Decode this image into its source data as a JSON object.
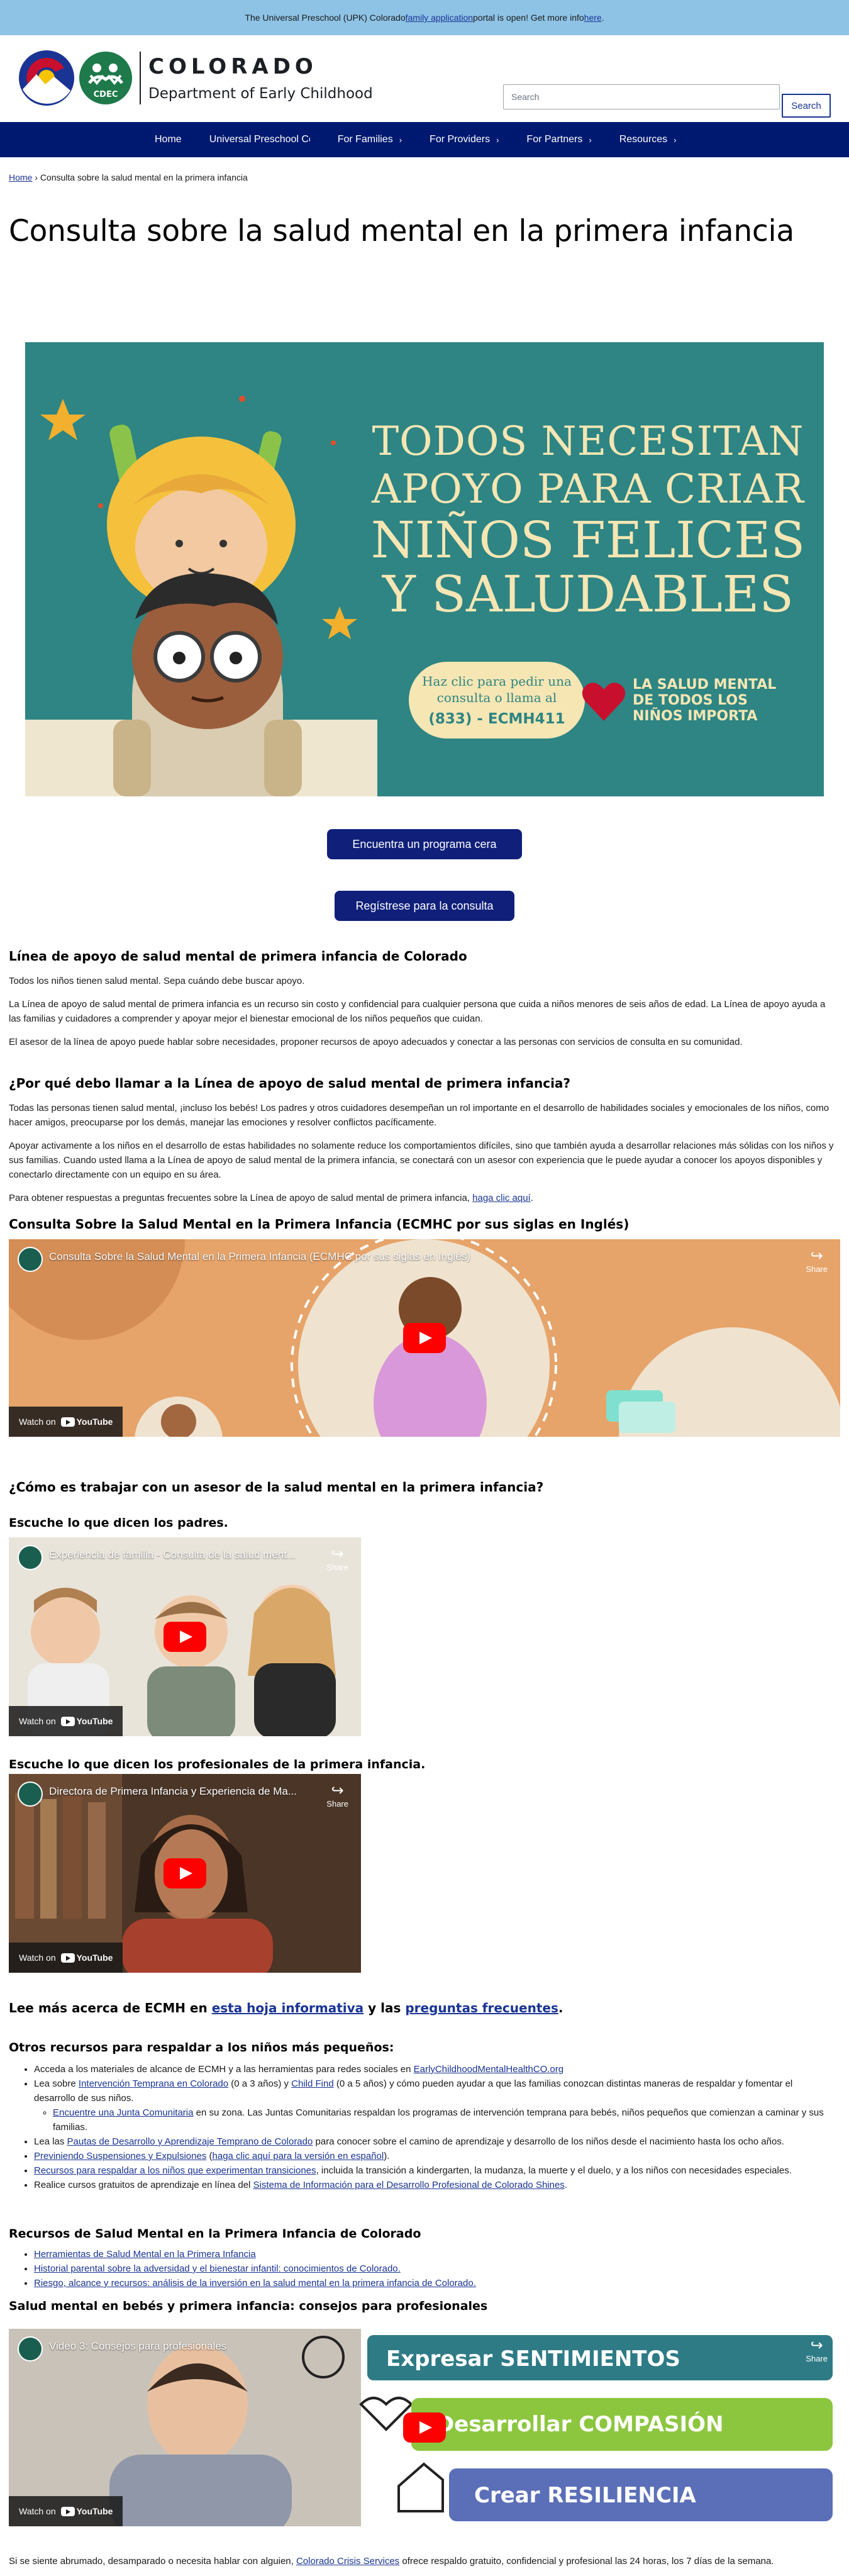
{
  "announcement": {
    "text_before": "The Universal Preschool (UPK) Colorado ",
    "link1": "family application",
    "text_middle": " portal is open! Get more info ",
    "link2": "here",
    "text_after": "."
  },
  "header": {
    "logo_state": "COLORADO",
    "logo_dept": "Department of Early Childhood",
    "logo_cdec": "CDEC",
    "search_placeholder": "Search",
    "search_button": "Search"
  },
  "nav": {
    "items": [
      {
        "label": "Home",
        "has_children": false
      },
      {
        "label": "Universal Preschool Colorado",
        "has_children": false
      },
      {
        "label": "For Families",
        "has_children": true
      },
      {
        "label": "For Providers",
        "has_children": true
      },
      {
        "label": "For Partners",
        "has_children": true
      },
      {
        "label": "Resources",
        "has_children": true
      }
    ],
    "chevron": "›"
  },
  "breadcrumb": {
    "home": "Home",
    "separator": "›",
    "current": "Consulta sobre la salud mental en la primera infancia"
  },
  "page_title": "Consulta sobre la salud mental en la primera infancia",
  "banner": {
    "headline_1": "TODOS NECESITAN",
    "headline_2": "APOYO PARA CRIAR",
    "headline_3": "NIÑOS FELICES",
    "headline_4": "Y SALUDABLES",
    "pill_line1": "Haz clic para pedir una",
    "pill_line2": "consulta o llama al",
    "pill_phone": "(833) - ECMH411",
    "tagline_1": "LA SALUD MENTAL",
    "tagline_2": "DE TODOS LOS",
    "tagline_3": "NIÑOS IMPORTA",
    "colors": {
      "background": "#2e8583",
      "text": "#f6e6b4",
      "heart": "#c8102e"
    }
  },
  "buttons": {
    "find_program": "Encuentra un programa cera",
    "register": "Regístrese para la consulta"
  },
  "section1": {
    "heading": "Línea de apoyo de salud mental de primera infancia de Colorado",
    "p1": "Todos los niños tienen salud mental. Sepa cuándo debe buscar apoyo.",
    "p2": "La Línea de apoyo de salud mental de primera infancia es un recurso sin costo y confidencial para cualquier persona que cuida a niños menores de seis años de edad. La Línea de apoyo ayuda a las familias y cuidadores a comprender y apoyar mejor el bienestar emocional de los niños pequeños que cuidan.",
    "p3": "El asesor de la línea de apoyo puede hablar sobre necesidades, proponer recursos de apoyo adecuados y conectar a las personas con servicios de consulta en su comunidad."
  },
  "section2": {
    "heading": "¿Por qué debo llamar a la Línea de apoyo de salud mental de primera infancia?",
    "p1": "Todas las personas tienen salud mental, ¡incluso los bebés! Los padres y otros cuidadores desempeñan un rol importante en el desarrollo de habilidades sociales y emocionales de los niños, como hacer amigos, preocuparse por los demás, manejar las emociones y resolver conflictos pacíficamente.",
    "p2": "Apoyar activamente a los niños en el desarrollo de estas habilidades no solamente reduce los comportamientos difíciles, sino que también ayuda a desarrollar relaciones más sólidas con los niños y sus familias. Cuando usted llama a la Línea de apoyo de salud mental de la primera infancia, se conectará con un asesor con experiencia que le puede ayudar a conocer los apoyos disponibles y conectarlo directamente con un equipo en su área.",
    "p3_before": "Para obtener respuestas a preguntas frecuentes sobre la Línea de apoyo de salud mental de primera infancia, ",
    "p3_link": "haga clic aquí",
    "p3_after": "."
  },
  "video_section": {
    "heading": "Consulta Sobre la Salud Mental en la Primera Infancia (ECMHC por sus siglas en Inglés)"
  },
  "videos": {
    "v1_title": "Consulta Sobre la Salud Mental en la Primera Infancia (ECMHC por sus siglas en Inglés)",
    "v2_title": "Experiencia de familia - Consulta de la salud ment...",
    "v3_title": "Directora de Primera Infancia y Experiencia de Ma...",
    "v4_title": "Video 3: Consejos para profesionales",
    "share": "Share",
    "watch_on": "Watch on",
    "youtube": "YouTube",
    "v4_overlay_1": "Expresar SENTIMIENTOS",
    "v4_overlay_2": "Desarrollar COMPASIÓN",
    "v4_overlay_3": "Crear RESILIENCIA"
  },
  "section3": {
    "heading": "¿Cómo es trabajar con un asesor de la salud mental en la primera infancia?",
    "parents_heading": "Escuche lo que dicen los padres.",
    "pros_heading": "Escuche lo que dicen los profesionales de la primera infancia."
  },
  "learn_more": {
    "before": "Lee más acerca de ECMH en ",
    "link1": "esta hoja informativa",
    "middle": " y las ",
    "link2": "preguntas frecuentes",
    "after": "."
  },
  "other_resources": {
    "heading": "Otros recursos para respaldar a los niños más pequeños:",
    "items": [
      {
        "before": "Acceda a los materiales de alcance de ECMH y a las herramientas para redes sociales en ",
        "link": "EarlyChildhoodMentalHealthCO.org",
        "after": ""
      },
      {
        "before": "Lea sobre ",
        "link": "Intervención Temprana en Colorado",
        "after": " (0 a 3 años) y ",
        "link2": "Child Find",
        "after2": " (0 a 5 años) y cómo pueden ayudar a que las familias conozcan distintas maneras de respaldar y fomentar el desarrollo de sus niños."
      },
      {
        "before": "Lea las ",
        "link": "Pautas de Desarrollo y Aprendizaje Temprano de Colorado",
        "after": " para conocer sobre el camino de aprendizaje y desarrollo de los niños desde el nacimiento hasta los ocho años."
      },
      {
        "before": "",
        "link": "Previniendo Suspensiones y Expulsiones",
        "after": " (",
        "link2": "haga clic aquí para la versión en español",
        "after2": ")."
      },
      {
        "before": "",
        "link": "Recursos para respaldar a los niños que experimentan transiciones",
        "after": ", incluida la transición a kindergarten, la mudanza, la muerte y el duelo, y a los niños con necesidades especiales."
      },
      {
        "before": "Realice cursos gratuitos de aprendizaje en línea del ",
        "link": "Sistema de Información para el Desarrollo Profesional de Colorado Shines",
        "after": "."
      }
    ],
    "subitem": {
      "link": "Encuentre una Junta Comunitaria",
      "after": " en su zona. Las Juntas Comunitarias respaldan los programas de intervención temprana para bebés, niños pequeños que comienzan a caminar y sus familias."
    }
  },
  "mh_resources": {
    "heading": "Recursos de Salud Mental en la Primera Infancia de Colorado",
    "items": [
      "Herramientas de Salud Mental en la Primera Infancia",
      "Historial parental sobre la adversidad y el bienestar infantil: conocimientos de Colorado.",
      "Riesgo, alcance y recursos: análisis de la inversión en la salud mental en la primera infancia de Colorado."
    ]
  },
  "tips_section": {
    "heading": "Salud mental en bebés y primera infancia: consejos para profesionales"
  },
  "crisis": {
    "before": "Si se siente abrumado, desamparado o necesita hablar con alguien, ",
    "link": "Colorado Crisis Services",
    "after": " ofrece respaldo gratuito, confidencial y profesional las 24 horas, los 7 días de la semana."
  }
}
